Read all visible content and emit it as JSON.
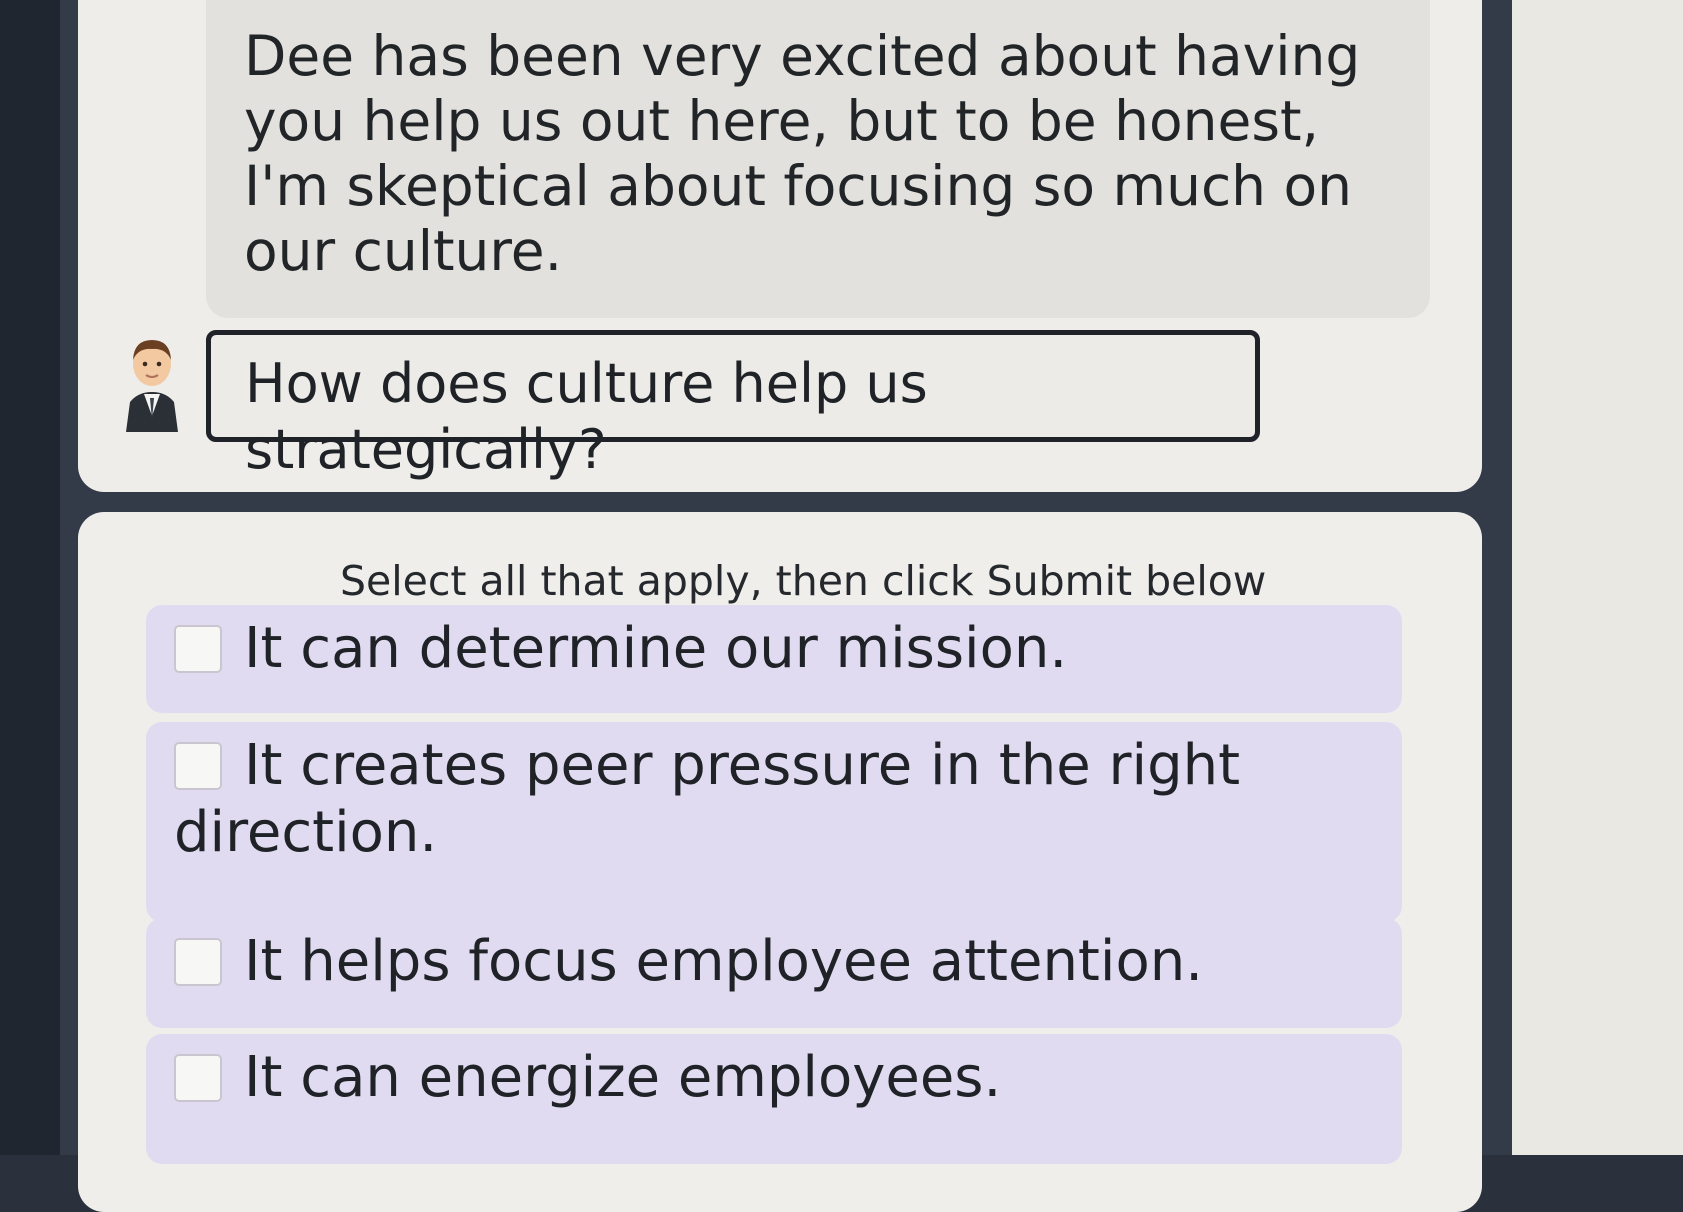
{
  "dialogue": {
    "speech_text": "Dee has been very excited about having you help us out here, but to be honest, I'm skeptical about focusing so much on our culture.",
    "question": "How does culture help us strategically?"
  },
  "quiz": {
    "instruction": "Select all that apply, then click Submit below",
    "options": [
      {
        "label": "It can determine our mission.",
        "checked": false
      },
      {
        "label": "It creates peer pressure in the right direction.",
        "checked": false
      },
      {
        "label": "It helps focus employee attention.",
        "checked": false
      },
      {
        "label": "It can energize employees.",
        "checked": false
      }
    ]
  },
  "icons": {
    "avatar": "person-avatar-icon",
    "checkbox": "checkbox-icon"
  },
  "colors": {
    "option_background": "#e1dbf1",
    "card_background": "#efeeeb",
    "speech_background": "#e2e1dd",
    "frame": "#333b49"
  }
}
